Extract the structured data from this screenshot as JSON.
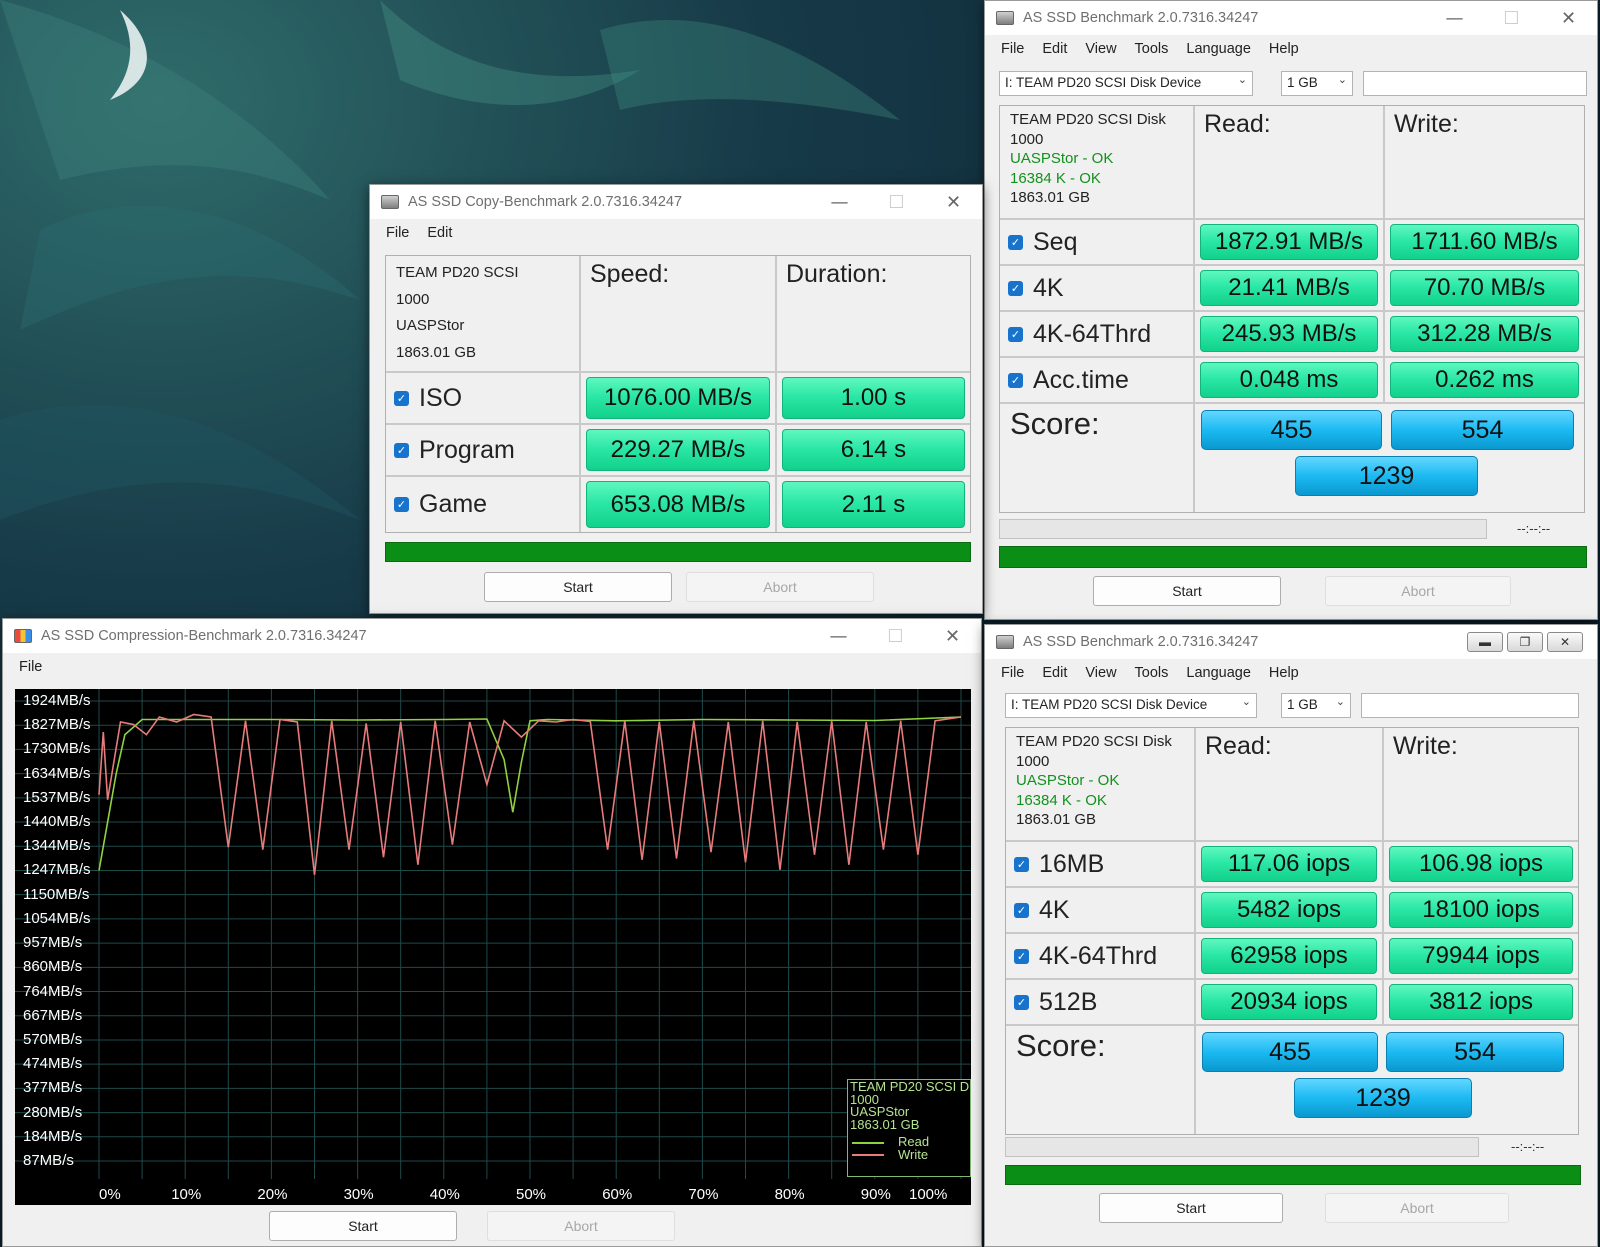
{
  "main_bench": {
    "title": "AS SSD Benchmark 2.0.7316.34247",
    "menu": [
      "File",
      "Edit",
      "View",
      "Tools",
      "Language",
      "Help"
    ],
    "drive": "I: TEAM PD20 SCSI Disk Device",
    "size": "1 GB",
    "info": {
      "name": "TEAM PD20 SCSI Disk",
      "fw": "1000",
      "driver": "UASPStor - OK",
      "align": "16384 K - OK",
      "capacity": "1863.01 GB"
    },
    "read_header": "Read:",
    "write_header": "Write:",
    "rows": [
      {
        "label": "Seq",
        "read": "1872.91 MB/s",
        "write": "1711.60 MB/s"
      },
      {
        "label": "4K",
        "read": "21.41 MB/s",
        "write": "70.70 MB/s"
      },
      {
        "label": "4K-64Thrd",
        "read": "245.93 MB/s",
        "write": "312.28 MB/s"
      },
      {
        "label": "Acc.time",
        "read": "0.048 ms",
        "write": "0.262 ms"
      }
    ],
    "score_label": "Score:",
    "score_read": "455",
    "score_write": "554",
    "score_total": "1239",
    "timer": "--:--:--",
    "start": "Start",
    "abort": "Abort"
  },
  "copy_bench": {
    "title": "AS SSD Copy-Benchmark 2.0.7316.34247",
    "menu": [
      "File",
      "Edit"
    ],
    "info": {
      "name": "TEAM PD20 SCSI",
      "fw": "1000",
      "driver": "UASPStor",
      "capacity": "1863.01 GB"
    },
    "speed_header": "Speed:",
    "duration_header": "Duration:",
    "rows": [
      {
        "label": "ISO",
        "speed": "1076.00 MB/s",
        "duration": "1.00 s"
      },
      {
        "label": "Program",
        "speed": "229.27 MB/s",
        "duration": "6.14 s"
      },
      {
        "label": "Game",
        "speed": "653.08 MB/s",
        "duration": "2.11 s"
      }
    ],
    "start": "Start",
    "abort": "Abort"
  },
  "compression_bench": {
    "title": "AS SSD Compression-Benchmark 2.0.7316.34247",
    "menu": [
      "File"
    ],
    "legend": {
      "name": "TEAM PD20 SCSI D",
      "fw": "1000",
      "driver": "UASPStor",
      "capacity": "1863.01 GB",
      "read": "Read",
      "write": "Write"
    },
    "start": "Start",
    "abort": "Abort"
  },
  "chart_data": {
    "type": "line",
    "y_tick_labels": [
      "1924MB/s",
      "1827MB/s",
      "1730MB/s",
      "1634MB/s",
      "1537MB/s",
      "1440MB/s",
      "1344MB/s",
      "1247MB/s",
      "1150MB/s",
      "1054MB/s",
      "957MB/s",
      "860MB/s",
      "764MB/s",
      "667MB/s",
      "570MB/s",
      "474MB/s",
      "377MB/s",
      "280MB/s",
      "184MB/s",
      "87MB/s"
    ],
    "x_tick_labels": [
      "0%",
      "10%",
      "20%",
      "30%",
      "40%",
      "50%",
      "60%",
      "70%",
      "80%",
      "90%",
      "100%"
    ],
    "ylim": [
      87,
      1924
    ],
    "xlim": [
      0,
      100
    ],
    "grid": true,
    "legend_position": "bottom-right",
    "colors": {
      "read": "#8fd13f",
      "write": "#e87b7b",
      "grid": "#1e4a4a"
    },
    "series": [
      {
        "name": "Read",
        "x": [
          0,
          1,
          2,
          3,
          5,
          10,
          20,
          30,
          40,
          45,
          47,
          48,
          49,
          50,
          52,
          60,
          70,
          80,
          90,
          100
        ],
        "y": [
          1247,
          1440,
          1634,
          1790,
          1850,
          1850,
          1850,
          1848,
          1850,
          1852,
          1690,
          1480,
          1680,
          1845,
          1850,
          1845,
          1850,
          1848,
          1846,
          1860
        ]
      },
      {
        "name": "Write",
        "x": [
          0,
          0.5,
          1,
          2.5,
          4,
          5.5,
          7,
          9,
          11,
          13,
          15,
          17,
          19,
          21,
          23,
          25,
          27,
          29,
          31,
          33,
          35,
          37,
          39,
          41,
          43,
          45,
          47,
          49,
          51,
          53,
          55,
          57,
          59,
          61,
          63,
          65,
          67,
          69,
          71,
          73,
          75,
          77,
          79,
          81,
          83,
          85,
          87,
          89,
          91,
          93,
          95,
          97,
          100
        ],
        "y": [
          1550,
          1800,
          1530,
          1840,
          1830,
          1790,
          1860,
          1840,
          1870,
          1860,
          1340,
          1845,
          1330,
          1850,
          1840,
          1230,
          1845,
          1330,
          1835,
          1300,
          1840,
          1270,
          1845,
          1350,
          1840,
          1590,
          1845,
          1780,
          1845,
          1840,
          1850,
          1842,
          1330,
          1845,
          1290,
          1840,
          1295,
          1845,
          1320,
          1840,
          1280,
          1845,
          1250,
          1840,
          1310,
          1845,
          1270,
          1840,
          1330,
          1845,
          1310,
          1845,
          1860
        ]
      }
    ]
  },
  "iops_bench": {
    "title": "AS SSD Benchmark 2.0.7316.34247",
    "menu": [
      "File",
      "Edit",
      "View",
      "Tools",
      "Language",
      "Help"
    ],
    "drive": "I: TEAM PD20 SCSI Disk Device",
    "size": "1 GB",
    "info": {
      "name": "TEAM PD20 SCSI Disk",
      "fw": "1000",
      "driver": "UASPStor - OK",
      "align": "16384 K - OK",
      "capacity": "1863.01 GB"
    },
    "read_header": "Read:",
    "write_header": "Write:",
    "rows": [
      {
        "label": "16MB",
        "read": "117.06 iops",
        "write": "106.98 iops"
      },
      {
        "label": "4K",
        "read": "5482 iops",
        "write": "18100 iops"
      },
      {
        "label": "4K-64Thrd",
        "read": "62958 iops",
        "write": "79944 iops"
      },
      {
        "label": "512B",
        "read": "20934 iops",
        "write": "3812 iops"
      }
    ],
    "score_label": "Score:",
    "score_read": "455",
    "score_write": "554",
    "score_total": "1239",
    "timer": "--:--:--",
    "start": "Start",
    "abort": "Abort"
  }
}
